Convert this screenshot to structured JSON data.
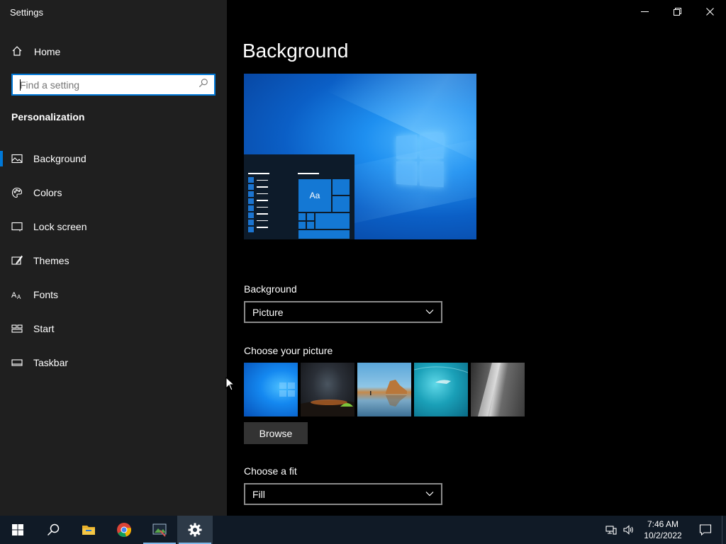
{
  "window": {
    "title": "Settings"
  },
  "sidebar": {
    "home_label": "Home",
    "search_placeholder": "Find a setting",
    "section_title": "Personalization",
    "items": [
      {
        "label": "Background",
        "icon": "picture-icon",
        "active": true
      },
      {
        "label": "Colors",
        "icon": "palette-icon",
        "active": false
      },
      {
        "label": "Lock screen",
        "icon": "lock-screen-icon",
        "active": false
      },
      {
        "label": "Themes",
        "icon": "themes-icon",
        "active": false
      },
      {
        "label": "Fonts",
        "icon": "fonts-icon",
        "active": false
      },
      {
        "label": "Start",
        "icon": "start-icon",
        "active": false
      },
      {
        "label": "Taskbar",
        "icon": "taskbar-icon",
        "active": false
      }
    ]
  },
  "main": {
    "title": "Background",
    "preview_tile_text": "Aa",
    "background_label": "Background",
    "background_value": "Picture",
    "choose_picture_label": "Choose your picture",
    "browse_label": "Browse",
    "choose_fit_label": "Choose a fit",
    "fit_value": "Fill"
  },
  "taskbar": {
    "apps": [
      "start-icon",
      "search-icon",
      "file-explorer-icon",
      "chrome-icon",
      "snipping-tool-icon",
      "settings-icon"
    ],
    "time": "7:46 AM",
    "date": "10/2/2022"
  },
  "colors": {
    "accent": "#0078d7",
    "sidebar_bg": "#1f1f1f",
    "main_bg": "#000000",
    "taskbar_bg": "#101a26"
  }
}
